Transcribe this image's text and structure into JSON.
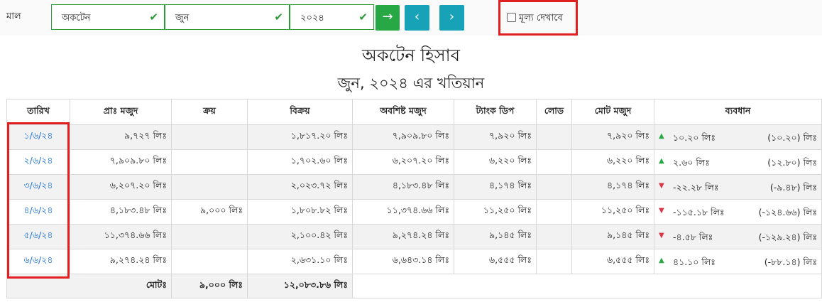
{
  "filter": {
    "label": "মাল",
    "product": "অকটেন",
    "month": "জুন",
    "year": "২০২৪",
    "go_icon": "→",
    "prev_icon": "‹",
    "next_icon": "›",
    "show_value_label": "মূল্য দেখাবে"
  },
  "heading": {
    "title": "অকটেন হিসাব",
    "subtitle": "জুন, ২০২৪ এর খতিয়ান"
  },
  "table": {
    "headers": [
      "তারিখ",
      "প্রাঃ মজুদ",
      "ক্রয়",
      "বিক্রয়",
      "অবশিষ্ট মজুদ",
      "ট্যাংক ডিপ",
      "লোড",
      "মোট মজুদ",
      "ব্যবধান"
    ],
    "rows": [
      {
        "date": "১/৬/২৪",
        "opening": "৯,৭২৭ লিঃ",
        "purchase": "",
        "sale": "১,৮১৭.২০ লিঃ",
        "remaining": "৭,৯০৯.৮০ লিঃ",
        "tank_dip": "৭,৯২০ লিঃ",
        "load": "",
        "total": "৭,৯২০ লিঃ",
        "diff_dir": "up",
        "diff": "১০.২০ লিঃ",
        "cum": "(১০.২০) লিঃ"
      },
      {
        "date": "২/৬/২৪",
        "opening": "৭,৯০৯.৮০ লিঃ",
        "purchase": "",
        "sale": "১,৭০২.৬০ লিঃ",
        "remaining": "৬,২০৭.২০ লিঃ",
        "tank_dip": "৬,২২০ লিঃ",
        "load": "",
        "total": "৬,২২০ লিঃ",
        "diff_dir": "up",
        "diff": "২.৬০ লিঃ",
        "cum": "(১২.৮০) লিঃ"
      },
      {
        "date": "৩/৬/২৪",
        "opening": "৬,২০৭.২০ লিঃ",
        "purchase": "",
        "sale": "২,০২৩.৭২ লিঃ",
        "remaining": "৪,১৮৩.৪৮ লিঃ",
        "tank_dip": "৪,১৭৪ লিঃ",
        "load": "",
        "total": "৪,১৭৪ লিঃ",
        "diff_dir": "down",
        "diff": "-২২.২৮ লিঃ",
        "cum": "(-৯.৪৮) লিঃ"
      },
      {
        "date": "৪/৬/২৪",
        "opening": "৪,১৮৩.৪৮ লিঃ",
        "purchase": "৯,০০০ লিঃ",
        "sale": "১,৮০৮.৮২ লিঃ",
        "remaining": "১১,৩৭৪.৬৬ লিঃ",
        "tank_dip": "১১,২৫০ লিঃ",
        "load": "",
        "total": "১১,২৫০ লিঃ",
        "diff_dir": "down",
        "diff": "-১১৫.১৮ লিঃ",
        "cum": "(-১২৪.৬৬) লিঃ"
      },
      {
        "date": "৫/৬/২৪",
        "opening": "১১,৩৭৪.৬৬ লিঃ",
        "purchase": "",
        "sale": "২,১০০.৪২ লিঃ",
        "remaining": "৯,২৭৪.২৪ লিঃ",
        "tank_dip": "৯,১৪৫ লিঃ",
        "load": "",
        "total": "৯,১৪৫ লিঃ",
        "diff_dir": "down",
        "diff": "-৪.৫৮ লিঃ",
        "cum": "(-১২৯.২৪) লিঃ"
      },
      {
        "date": "৬/৬/২৪",
        "opening": "৯,২৭৪.২৪ লিঃ",
        "purchase": "",
        "sale": "২,৬৩১.১০ লিঃ",
        "remaining": "৬,৬৪৩.১৪ লিঃ",
        "tank_dip": "৬,৫৫৫ লিঃ",
        "load": "",
        "total": "৬,৫৫৫ লিঃ",
        "diff_dir": "up",
        "diff": "৪১.১০ লিঃ",
        "cum": "(-৮৮.১৪) লিঃ"
      }
    ],
    "footer": {
      "label": "মোটঃ",
      "purchase_total": "৯,০০০ লিঃ",
      "sale_total": "১২,০৮৩.৮৬ লিঃ"
    }
  }
}
